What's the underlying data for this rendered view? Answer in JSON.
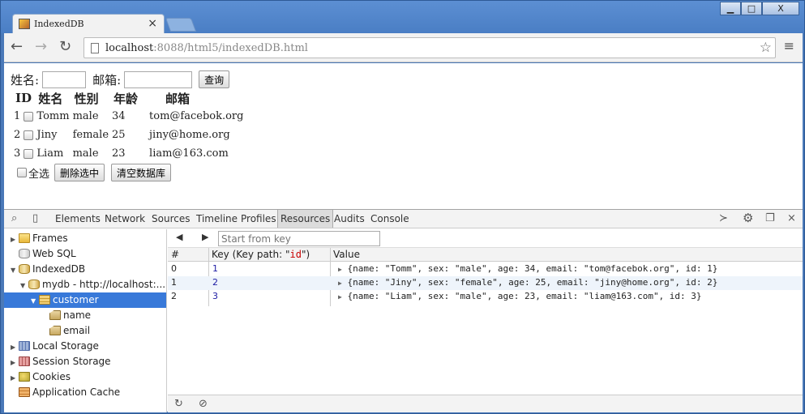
{
  "browser": {
    "tab_title": "IndexedDB",
    "tab_close": "×",
    "url_host": "localhost",
    "url_path": ":8088/html5/indexedDB.html",
    "win_minimize": "▁",
    "win_maximize": "□",
    "win_close": "X"
  },
  "page": {
    "name_label": "姓名:",
    "email_label": "邮箱:",
    "query_button": "查询",
    "table_headers": [
      "ID",
      "姓名",
      "性别",
      "年龄",
      "邮箱"
    ],
    "rows": [
      {
        "id": "1",
        "name": "Tomm",
        "sex": "male",
        "age": "34",
        "email": "tom@facebok.org"
      },
      {
        "id": "2",
        "name": "Jiny",
        "sex": "female",
        "age": "25",
        "email": "jiny@home.org"
      },
      {
        "id": "3",
        "name": "Liam",
        "sex": "male",
        "age": "23",
        "email": "liam@163.com"
      }
    ],
    "select_all_label": "全选",
    "delete_selected_button": "删除选中",
    "clear_db_button": "清空数据库"
  },
  "devtools": {
    "tabs": [
      "Elements",
      "Network",
      "Sources",
      "Timeline",
      "Profiles",
      "Resources",
      "Audits",
      "Console"
    ],
    "active_tab": "Resources",
    "tree": [
      {
        "label": "Frames",
        "icon": "folder-icon"
      },
      {
        "label": "Web SQL",
        "icon": "database-icon"
      },
      {
        "label": "IndexedDB",
        "icon": "indexeddb-icon"
      },
      {
        "label": "mydb - http://localhost:...",
        "icon": "database-icon"
      },
      {
        "label": "customer",
        "icon": "object-store-icon"
      },
      {
        "label": "name",
        "icon": "index-icon"
      },
      {
        "label": "email",
        "icon": "index-icon"
      },
      {
        "label": "Local Storage",
        "icon": "local-storage-icon"
      },
      {
        "label": "Session Storage",
        "icon": "session-storage-icon"
      },
      {
        "label": "Cookies",
        "icon": "cookie-icon"
      },
      {
        "label": "Application Cache",
        "icon": "app-cache-icon"
      }
    ],
    "start_from_key_placeholder": "Start from key",
    "grid_headers": {
      "num": "#",
      "key_prefix": "Key (Key path: \"",
      "key_path": "id",
      "key_suffix": "\")",
      "value": "Value"
    },
    "entries": [
      {
        "num": "0",
        "key": "1",
        "value": "{name: \"Tomm\", sex: \"male\", age: 34, email: \"tom@facebok.org\", id: 1}"
      },
      {
        "num": "1",
        "key": "2",
        "value": "{name: \"Jiny\", sex: \"female\", age: 25, email: \"jiny@home.org\", id: 2}"
      },
      {
        "num": "2",
        "key": "3",
        "value": "{name: \"Liam\", sex: \"male\", age: 23, email: \"liam@163.com\", id: 3}"
      }
    ]
  }
}
